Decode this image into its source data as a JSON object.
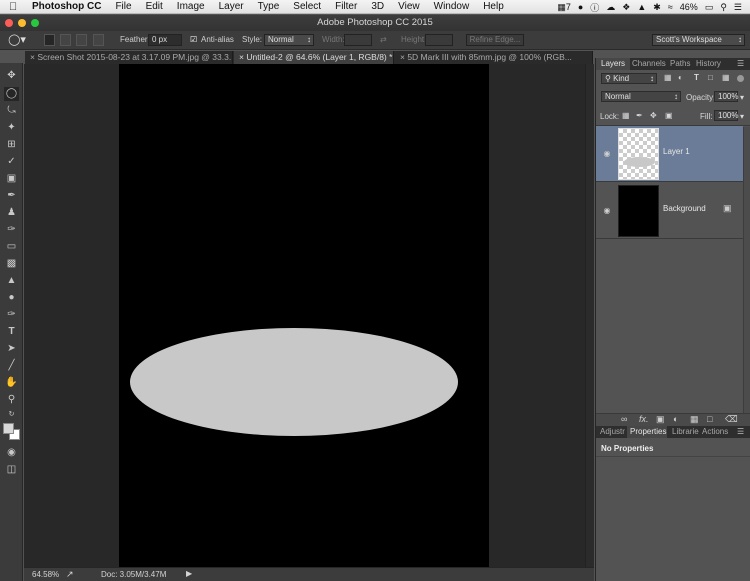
{
  "menubar": {
    "app_name": "Photoshop CC",
    "items": [
      "File",
      "Edit",
      "Image",
      "Layer",
      "Type",
      "Select",
      "Filter",
      "3D",
      "View",
      "Window",
      "Help"
    ],
    "status": {
      "badge": "7",
      "battery": "46%"
    }
  },
  "window": {
    "title": "Adobe Photoshop CC 2015"
  },
  "options": {
    "feather_label": "Feather:",
    "feather_value": "0 px",
    "antialias_label": "Anti-alias",
    "style_label": "Style:",
    "style_value": "Normal",
    "width_label": "Width:",
    "height_label": "Height:",
    "refine_edge": "Refine Edge...",
    "workspace": "Scott's Workspace"
  },
  "tabs": [
    {
      "label": "Screen Shot 2015-08-23 at 3.17.09 PM.jpg @ 33.3..."
    },
    {
      "label": "Untitled-2 @ 64.6% (Layer 1, RGB/8) *"
    },
    {
      "label": "5D Mark III with 85mm.jpg @ 100% (RGB..."
    }
  ],
  "canvas": {
    "background": "#000000",
    "ellipse_color": "#c8c8c8"
  },
  "status": {
    "zoom": "64.58%",
    "doc": "Doc: 3.05M/3.47M"
  },
  "layers_panel": {
    "tabs": [
      "Layers",
      "Channels",
      "Paths",
      "History"
    ],
    "kind": "Kind",
    "blend": "Normal",
    "opacity_label": "Opacity:",
    "opacity_value": "100%",
    "lock_label": "Lock:",
    "fill_label": "Fill:",
    "fill_value": "100%",
    "layers": [
      {
        "name": "Layer 1",
        "selected": true
      },
      {
        "name": "Background",
        "selected": false
      }
    ]
  },
  "properties_panel": {
    "tabs": [
      "Adjustr",
      "Properties",
      "Librarie",
      "Actions"
    ],
    "empty_text": "No Properties"
  }
}
